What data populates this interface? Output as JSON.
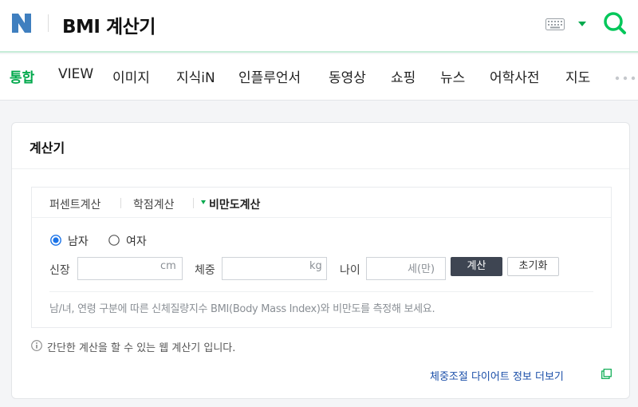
{
  "header": {
    "logo_letter": "N",
    "search_query": "BMI 계산기",
    "colors": {
      "brand": "#03c75a",
      "logo_blue": "#2b6cb0"
    },
    "icons": [
      "keyboard-icon",
      "dropdown-arrow-icon",
      "search-icon"
    ]
  },
  "tabs": [
    {
      "label": "통합",
      "active": true
    },
    {
      "label": "VIEW"
    },
    {
      "label": "이미지"
    },
    {
      "label": "지식iN"
    },
    {
      "label": "인플루언서"
    },
    {
      "label": "동영상"
    },
    {
      "label": "쇼핑"
    },
    {
      "label": "뉴스"
    },
    {
      "label": "어학사전"
    },
    {
      "label": "지도"
    }
  ],
  "panel": {
    "title": "계산기",
    "calc_tabs": [
      {
        "label": "퍼센트계산"
      },
      {
        "label": "학점계산"
      },
      {
        "label": "비만도계산",
        "active": true
      }
    ],
    "gender": {
      "male": "남자",
      "female": "여자",
      "selected": "남자"
    },
    "fields": {
      "height": {
        "label": "신장",
        "unit": "cm",
        "value": ""
      },
      "weight": {
        "label": "체중",
        "unit": "kg",
        "value": ""
      },
      "age": {
        "label": "나이",
        "unit": "세(만)",
        "value": ""
      }
    },
    "buttons": {
      "calc": "계산",
      "reset": "초기화"
    },
    "description": "남/녀, 연령 구분에 따른 신체질량지수 BMI(Body Mass Index)와 비만도를 측정해 보세요.",
    "info": "간단한 계산을 할 수 있는 웹 계산기 입니다.",
    "more_link": "체중조절 다이어트 정보 더보기"
  }
}
